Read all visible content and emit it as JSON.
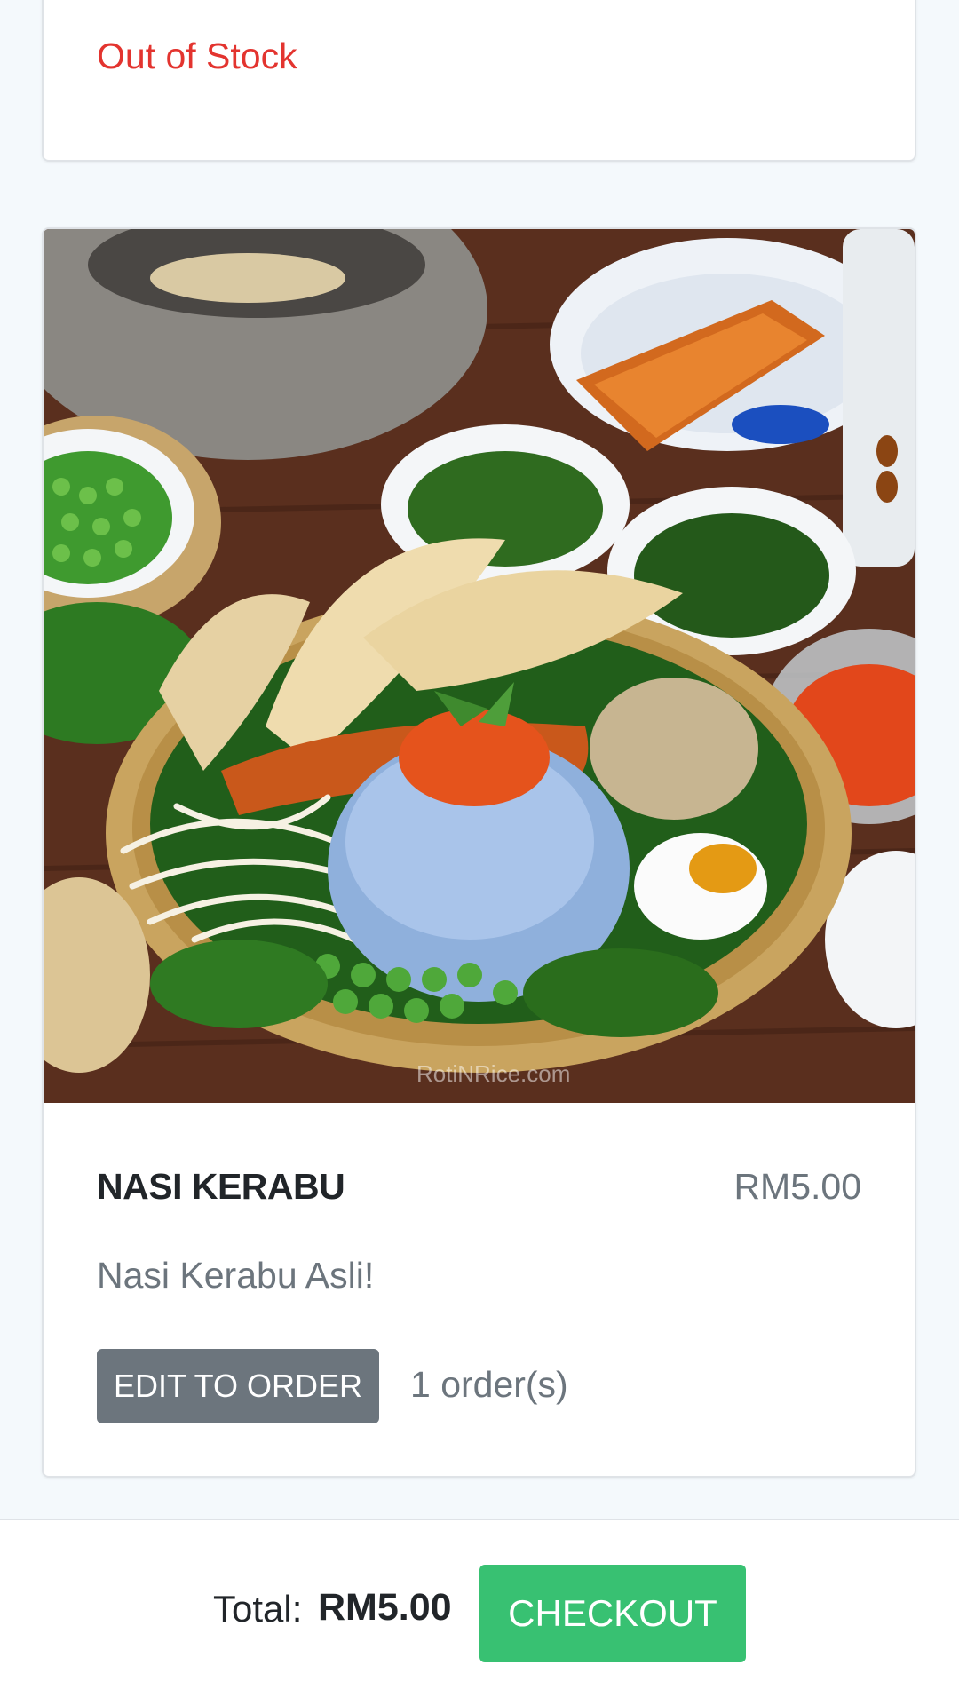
{
  "previous_item": {
    "stock_status": "Out of Stock",
    "stock_status_color": "#e3342f"
  },
  "item": {
    "image_icon": "food-photo",
    "image_watermark": "RotiNRice.com",
    "title": "NASI KERABU",
    "price": "RM5.00",
    "description": "Nasi Kerabu Asli!",
    "edit_button_label": "EDIT TO ORDER",
    "order_count": "1 order(s)"
  },
  "footer": {
    "total_label": "Total:",
    "total_amount": "RM5.00",
    "checkout_label": "CHECKOUT"
  },
  "colors": {
    "background": "#f4f9fc",
    "edit_button": "#6c757d",
    "checkout_button": "#38c172",
    "muted_text": "#6c757d",
    "title_text": "#212529"
  }
}
